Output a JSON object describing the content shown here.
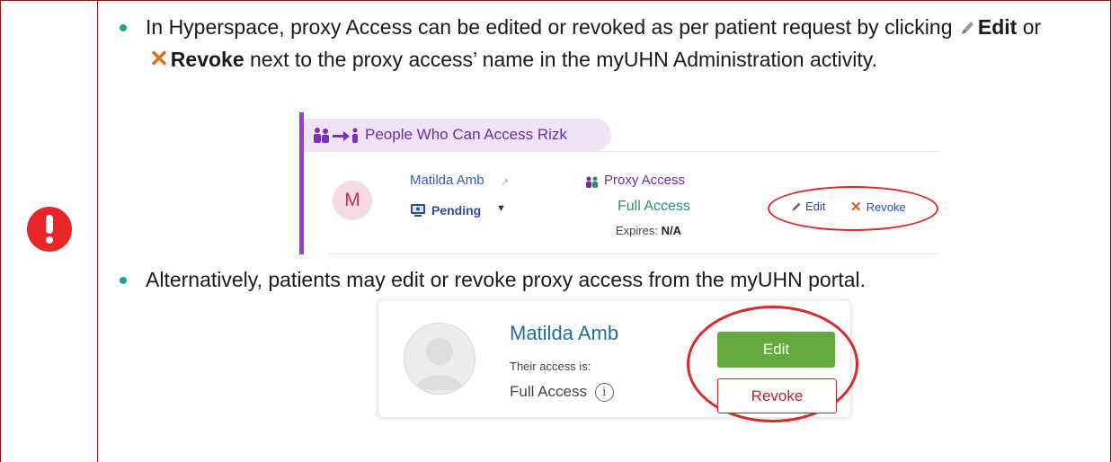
{
  "callout": {
    "icon": "exclamation-icon",
    "icon_color": "#e8262a",
    "border_color": "#8b1a1a",
    "bullet_color": "#1fa38a"
  },
  "bullet1": {
    "before": "In Hyperspace, proxy Access can be edited or revoked as per patient request by clicking",
    "edit": "Edit",
    "or": "or",
    "revoke": "Revoke",
    "after": "next to the proxy access’ name in the myUHN Administration activity."
  },
  "hyperspace": {
    "section_title": "People Who Can Access Rizk",
    "avatar_letter": "M",
    "name": "Matilda Amb",
    "status": "Pending",
    "access_label": "Proxy Access",
    "access_level": "Full Access",
    "expires_label": "Expires:",
    "expires_value": "N/A",
    "edit_label": "Edit",
    "revoke_label": "Revoke"
  },
  "bullet2": {
    "text": "Alternatively, patients may edit or revoke proxy access from the myUHN portal."
  },
  "myuhn": {
    "name": "Matilda Amb",
    "their_access": "Their access is:",
    "access_level": "Full Access",
    "info_glyph": "i",
    "edit_label": "Edit",
    "revoke_label": "Revoke",
    "edit_color": "#65a83d",
    "revoke_color": "#b3252a"
  }
}
